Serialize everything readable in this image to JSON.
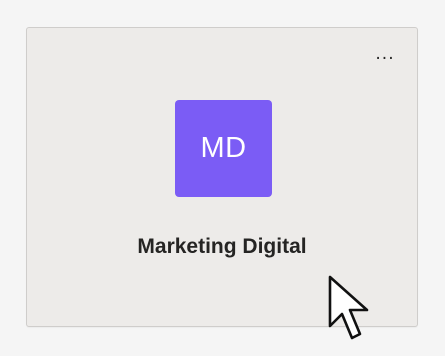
{
  "team_card": {
    "name": "Marketing Digital",
    "initials": "MD",
    "more_options_label": "...",
    "avatar_color": "#7b5cf5"
  },
  "colors": {
    "page_background": "#f5f5f5",
    "card_background": "#edebe9",
    "text_primary": "#252423"
  },
  "icons": {
    "more": "more-options-icon",
    "cursor": "mouse-pointer-icon"
  }
}
